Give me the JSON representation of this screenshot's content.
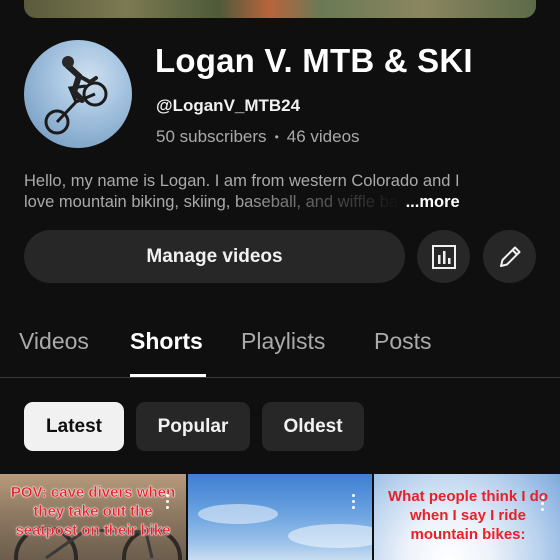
{
  "channel": {
    "name": "Logan V. MTB & SKI",
    "handle": "@LoganV_MTB24",
    "subscribers": "50 subscribers",
    "videos": "46 videos",
    "description_line1": "Hello, my name is Logan. I am from western Colorado and I",
    "description_line2": "love mountain biking, skiing, baseball, and wiffle bal",
    "more_label": "...more"
  },
  "actions": {
    "manage_label": "Manage videos",
    "stats_icon": "bar-chart-icon",
    "edit_icon": "pencil-icon"
  },
  "tabs": [
    {
      "label": "Videos",
      "active": false
    },
    {
      "label": "Shorts",
      "active": true
    },
    {
      "label": "Playlists",
      "active": false
    },
    {
      "label": "Posts",
      "active": false
    }
  ],
  "filters": [
    {
      "label": "Latest",
      "active": true
    },
    {
      "label": "Popular",
      "active": false
    },
    {
      "label": "Oldest",
      "active": false
    }
  ],
  "shorts": [
    {
      "caption": "POV: cave divers when they take out the seatpost on their bike"
    },
    {
      "caption": ""
    },
    {
      "caption": "What people think I do when I say I ride mountain bikes:"
    }
  ],
  "colors": {
    "background": "#0f0f0f",
    "surface": "#272727",
    "caption_red": "#e8202a"
  }
}
